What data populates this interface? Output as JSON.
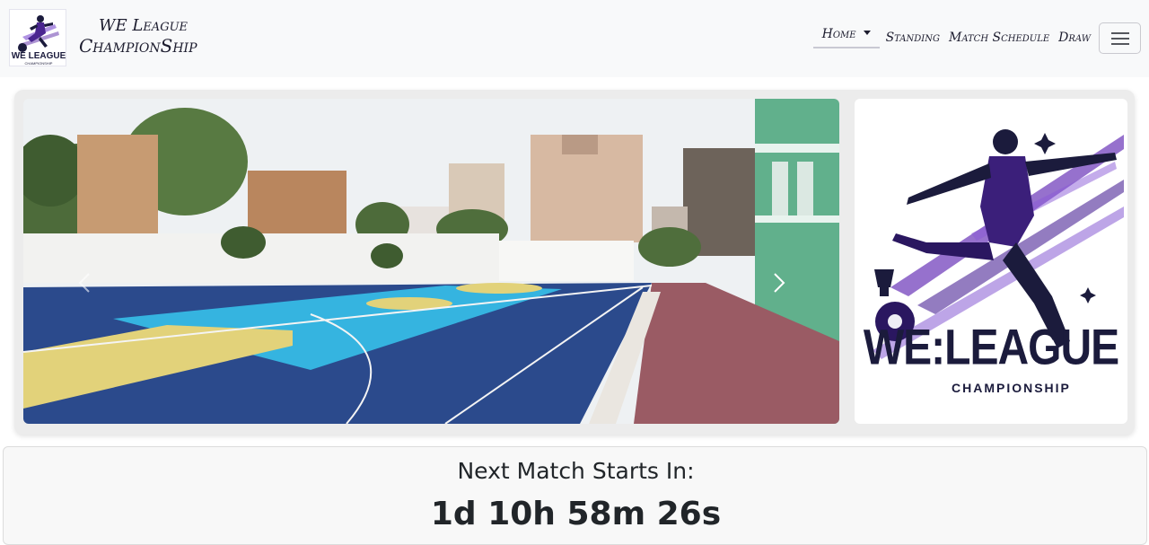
{
  "brand": {
    "line1": "WE League",
    "line2": "ChampionShip",
    "logo_text": "WE LEAGUE",
    "logo_subtext": "CHAMPIONSHIP"
  },
  "nav": {
    "items": [
      {
        "label": "Home",
        "active": true,
        "dropdown": true
      },
      {
        "label": "Standing"
      },
      {
        "label": "Match Schedule"
      },
      {
        "label": "Draw"
      }
    ],
    "toggler_icon": "hamburger-icon"
  },
  "carousel": {
    "prev_icon": "chevron-left-icon",
    "next_icon": "chevron-right-icon"
  },
  "side_logo": {
    "title": "WE:LEAGUE",
    "subtitle": "CHAMPIONSHIP"
  },
  "countdown": {
    "title": "Next Match Starts In:",
    "value": "1d 10h 58m 26s"
  },
  "colors": {
    "navbar_bg": "#f8f9fa",
    "brand_purple": "#5b2aa8",
    "court_blue": "#2b4a8c",
    "court_cyan": "#35b4e0",
    "court_yellow": "#e2d27a"
  }
}
